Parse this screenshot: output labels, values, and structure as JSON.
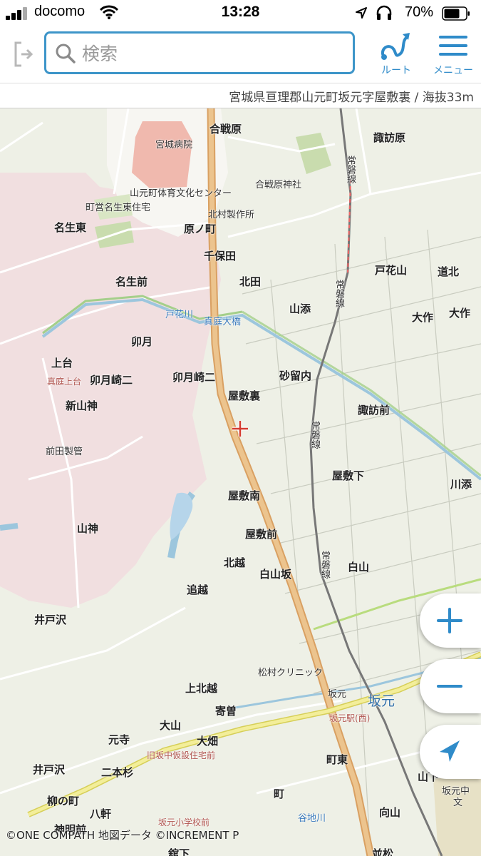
{
  "status_bar": {
    "carrier": "docomo",
    "time": "13:28",
    "battery": "70%"
  },
  "toolbar": {
    "search_placeholder": "検索",
    "route_label": "ルート",
    "menu_label": "メニュー"
  },
  "address_bar": {
    "text": "宮城県亘理郡山元町坂元字屋敷裏 / 海抜33m"
  },
  "map": {
    "labels": {
      "kassenbara": "合戦原",
      "suwahara": "諏訪原",
      "miyagi_hospital": "宮城病院",
      "kassenbara_shrine": "合戦原神社",
      "gym_center": "山元町体育文化センター",
      "municipal_housing": "町営名生東住宅",
      "kitamura": "北村製作所",
      "namyuhigashi": "名生東",
      "harunomachi": "原ノ町",
      "chihoda": "千保田",
      "namyumae": "名生前",
      "kitada": "北田",
      "tobanayama": "戸花山",
      "michikita": "道北",
      "yamazoe": "山添",
      "taisaku1": "大作",
      "taisaku2": "大作",
      "tobanagawa": "戸花川",
      "maniwa_bridge": "真庭大橋",
      "uzuki": "卯月",
      "uwadai": "上台",
      "maniwa_uwadai": "真庭上台",
      "uzukizaki2a": "卯月崎二",
      "uzukizaki2b": "卯月崎二",
      "saruuchi": "砂留内",
      "yashikiura": "屋敷裏",
      "shinyamagami": "新山神",
      "suwamae": "諏訪前",
      "maeda": "前田製管",
      "yashikishita": "屋敷下",
      "kawazoe": "川添",
      "yashikiminami": "屋敷南",
      "yamagami": "山神",
      "yashikimae": "屋敷前",
      "kitakoshi": "北越",
      "shirayamazaka": "白山坂",
      "hakusan": "白山",
      "oikoshi": "追越",
      "idosawa1": "井戸沢",
      "matsumura": "松村クリニック",
      "kamikitakoshi": "上北越",
      "sakamoto_small": "坂元",
      "sakamoto_station": "坂元",
      "sakamoto_eki": "坂元駅(西)",
      "yoriso": "寄曽",
      "oyama": "大山",
      "motodera": "元寺",
      "ohata": "大畑",
      "kasetsu": "旧坂中仮設住宅前",
      "machihigashi": "町東",
      "idosawa2": "井戸沢",
      "nihonsugi": "二本杉",
      "yamashita": "山下",
      "sakamoto_jh": "坂元中",
      "yanaginomachi": "柳の町",
      "machi": "町",
      "yaken": "八軒",
      "yachikawa": "谷地川",
      "mukaiyama": "向山",
      "shinmeimae": "神明前",
      "sakamoto_es": "坂元小学校前",
      "joban1": "常磐線",
      "joban2": "常磐線",
      "joban3": "常磐線",
      "joban4": "常磐線",
      "kanshita": "舘下",
      "namimatsu": "並松",
      "school_mark": "文"
    }
  },
  "copyright": "©ONE COMPATH 地図データ ©INCREMENT P",
  "icons": {
    "search": "search-icon",
    "route": "route-icon",
    "menu": "menu-icon",
    "zoom_in": "plus-icon",
    "zoom_out": "minus-icon",
    "locate": "location-arrow-icon",
    "crosshair": "crosshair-icon"
  },
  "colors": {
    "accent": "#2f8bc9",
    "search_border": "#3d95c9",
    "map_background": "#eef0e6",
    "residential_pink": "#f1dfe0",
    "main_road": "#e2b883",
    "crosshair": "#d43a2f"
  }
}
